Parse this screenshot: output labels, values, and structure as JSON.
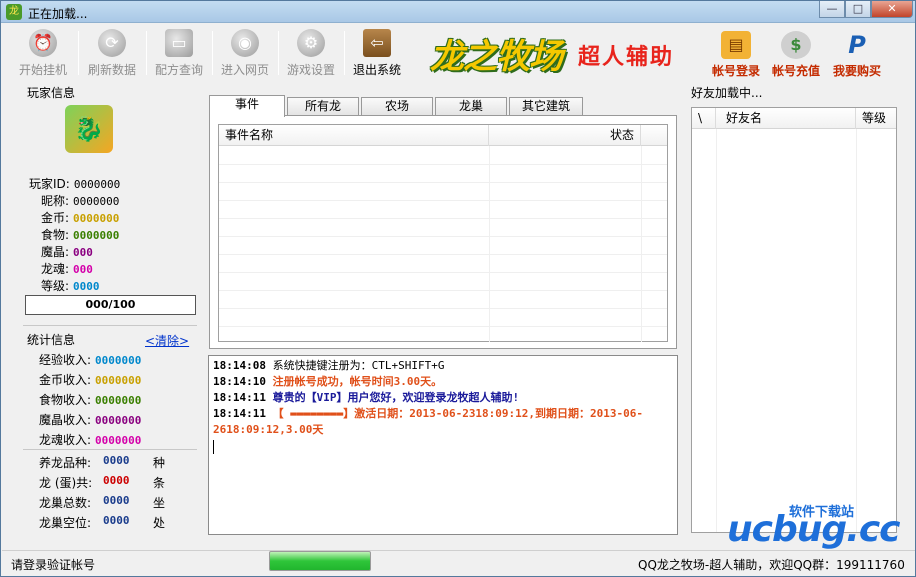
{
  "window": {
    "title": "正在加载...",
    "app_icon": "app-dragon-icon",
    "min_label": "—",
    "max_label": "□",
    "close_label": "✕"
  },
  "toolbar": {
    "items": [
      {
        "label": "开始挂机",
        "icon": "alarm-clock-icon",
        "glyph": "⏰"
      },
      {
        "label": "刷新数据",
        "icon": "refresh-icon",
        "glyph": "⟳"
      },
      {
        "label": "配方查询",
        "icon": "recipe-icon",
        "glyph": "▭"
      },
      {
        "label": "进入网页",
        "icon": "globe-icon",
        "glyph": "◉"
      },
      {
        "label": "游戏设置",
        "icon": "gear-icon",
        "glyph": "⚙"
      },
      {
        "label": "退出系统",
        "icon": "exit-door-icon",
        "glyph": "⇦"
      }
    ],
    "logo_main": "龙之牧场",
    "logo_sub": "超人辅助",
    "right_items": [
      {
        "label": "帐号登录",
        "icon": "account-login-icon",
        "glyph": "▤",
        "color": "#d4860b"
      },
      {
        "label": "帐号充值",
        "icon": "money-bag-icon",
        "glyph": "$",
        "color": "#3b8a3b"
      },
      {
        "label": "我要购买",
        "icon": "paypal-icon",
        "glyph": "P",
        "color": "#1a5fb4"
      }
    ]
  },
  "player": {
    "section_title": "玩家信息",
    "fields": [
      {
        "label": "玩家ID:",
        "value": "0000000",
        "color": "#000000"
      },
      {
        "label": "昵称:",
        "value": "0000000",
        "color": "#000000"
      },
      {
        "label": "金币:",
        "value": "0000000",
        "color": "#c8a000"
      },
      {
        "label": "食物:",
        "value": "0000000",
        "color": "#3a7f00"
      },
      {
        "label": "魔晶:",
        "value": "000",
        "color": "#8a0080"
      },
      {
        "label": "龙魂:",
        "value": "000",
        "color": "#d400aa"
      },
      {
        "label": "等级:",
        "value": "0000",
        "color": "#0088cc"
      }
    ],
    "progress": "000/100"
  },
  "stats": {
    "section_title": "统计信息",
    "clear_link": "<清除>",
    "income": [
      {
        "label": "经验收入:",
        "value": "0000000",
        "color": "#0088cc"
      },
      {
        "label": "金币收入:",
        "value": "0000000",
        "color": "#c8a000"
      },
      {
        "label": "食物收入:",
        "value": "0000000",
        "color": "#3a7f00"
      },
      {
        "label": "魔晶收入:",
        "value": "0000000",
        "color": "#8a0080"
      },
      {
        "label": "龙魂收入:",
        "value": "0000000",
        "color": "#d400aa"
      }
    ],
    "counts": [
      {
        "label": "养龙品种:",
        "value": "0000",
        "unit": "种",
        "color": "#1a3c8c"
      },
      {
        "label": "龙 (蛋)共:",
        "value": "0000",
        "unit": "条",
        "color": "#cc0000"
      },
      {
        "label": "龙巢总数:",
        "value": "0000",
        "unit": "坐",
        "color": "#1a3c8c"
      },
      {
        "label": "龙巢空位:",
        "value": "0000",
        "unit": "处",
        "color": "#1a3c8c"
      }
    ]
  },
  "tabs": [
    "事件",
    "所有龙",
    "农场",
    "龙巢",
    "其它建筑"
  ],
  "events_table": {
    "columns": [
      "事件名称",
      "状态"
    ]
  },
  "log": [
    {
      "time": "18:14:08",
      "text": "系统快捷键注册为：CTL+SHIFT+G",
      "color": "#000000",
      "bold": false
    },
    {
      "time": "18:14:10",
      "text": "注册帐号成功，帐号时间3.00天。",
      "color": "#e0501a",
      "bold": true
    },
    {
      "time": "18:14:11",
      "text": "尊贵的【VIP】用户您好，欢迎登录龙牧超人辅助!",
      "color": "#1a1a9a",
      "bold": true
    },
    {
      "time": "18:14:11",
      "text": "【 ▬▬▬▬▬▬▬▬】激活日期：2013-06-2318:09:12,到期日期：2013-06-2618:09:12,3.00天",
      "color": "#e0501a",
      "bold": true
    }
  ],
  "friends": {
    "section_title": "好友加载中...",
    "columns": [
      "\\",
      "好友名",
      "等级"
    ]
  },
  "statusbar": {
    "left": "请登录验证帐号",
    "progress": 1.0,
    "right": "QQ龙之牧场-超人辅助，欢迎QQ群：199111760"
  },
  "watermark": {
    "text": "ucbug.cc",
    "caption": "软件下载站"
  }
}
